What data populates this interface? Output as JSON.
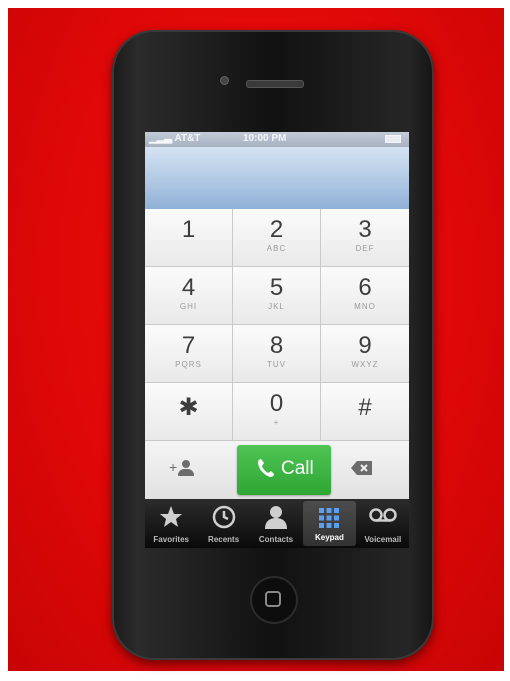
{
  "status_bar": {
    "carrier": "AT&T",
    "time": "10:00 PM"
  },
  "keypad": {
    "keys": [
      {
        "digit": "1",
        "letters": ""
      },
      {
        "digit": "2",
        "letters": "ABC"
      },
      {
        "digit": "3",
        "letters": "DEF"
      },
      {
        "digit": "4",
        "letters": "GHI"
      },
      {
        "digit": "5",
        "letters": "JKL"
      },
      {
        "digit": "6",
        "letters": "MNO"
      },
      {
        "digit": "7",
        "letters": "PQRS"
      },
      {
        "digit": "8",
        "letters": "TUV"
      },
      {
        "digit": "9",
        "letters": "WXYZ"
      },
      {
        "digit": "✱",
        "letters": ""
      },
      {
        "digit": "0",
        "letters": "+"
      },
      {
        "digit": "#",
        "letters": ""
      }
    ]
  },
  "actions": {
    "add_contact_icon": "add-contact-icon",
    "call_label": "Call",
    "delete_icon": "delete-icon"
  },
  "tabs": [
    {
      "label": "Favorites",
      "icon": "star-icon"
    },
    {
      "label": "Recents",
      "icon": "clock-icon"
    },
    {
      "label": "Contacts",
      "icon": "person-icon"
    },
    {
      "label": "Keypad",
      "icon": "keypad-icon"
    },
    {
      "label": "Voicemail",
      "icon": "voicemail-icon"
    }
  ],
  "active_tab": "Keypad",
  "colors": {
    "background": "#e00808",
    "call_button": "#2ea634",
    "status_bar": "#a5afbf",
    "display": "#adc6e2"
  }
}
